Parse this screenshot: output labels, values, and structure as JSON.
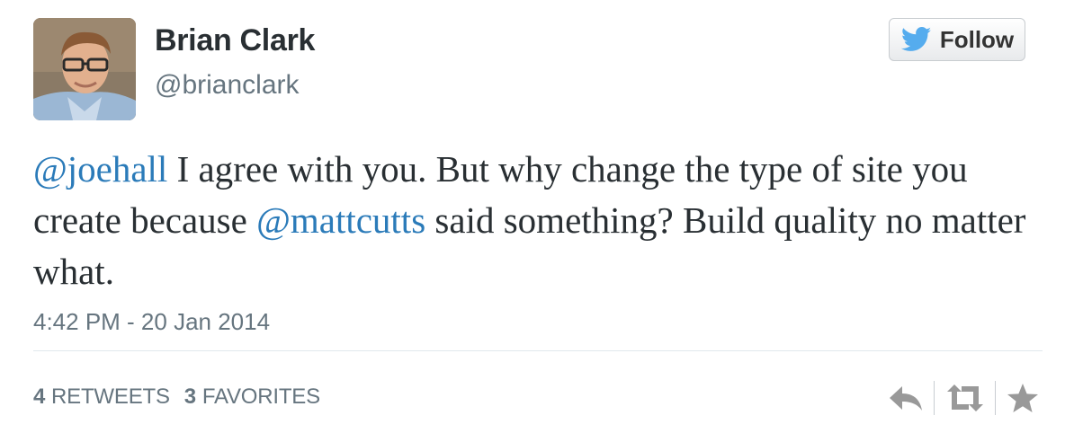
{
  "author": {
    "name": "Brian Clark",
    "handle": "@brianclark"
  },
  "follow_button": {
    "label": "Follow",
    "icon": "twitter-bird-icon"
  },
  "tweet": {
    "segments": [
      {
        "type": "mention",
        "text": "@joehall"
      },
      {
        "type": "text",
        "text": " I agree with you. But why change the type of site you create because "
      },
      {
        "type": "mention",
        "text": "@mattcutts"
      },
      {
        "type": "text",
        "text": " said something? Build quality no matter what."
      }
    ]
  },
  "timestamp": "4:42 PM - 20 Jan 2014",
  "stats": {
    "retweets_count": "4",
    "retweets_label": "RETWEETS",
    "favorites_count": "3",
    "favorites_label": "FAVORITES"
  },
  "actions": [
    {
      "name": "reply",
      "icon": "reply-icon"
    },
    {
      "name": "retweet",
      "icon": "retweet-icon"
    },
    {
      "name": "favorite",
      "icon": "star-icon"
    }
  ],
  "colors": {
    "link": "#2b7bb9",
    "text": "#292f33",
    "muted": "#66757f",
    "twitter_blue": "#55acee",
    "icon_gray": "#999999"
  }
}
